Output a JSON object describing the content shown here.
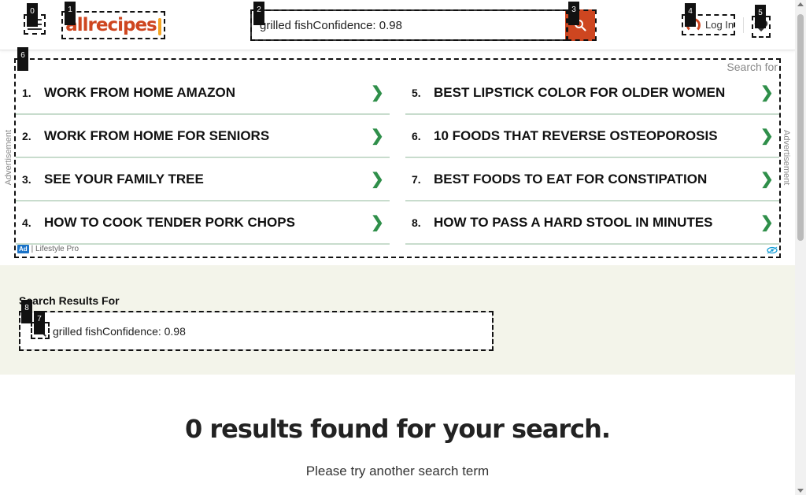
{
  "header": {
    "menu_icon": "hamburger-icon",
    "logo_text": "allrecipes",
    "search": {
      "value": "grilled fishConfidence: 0.98",
      "placeholder": ""
    },
    "search_icon": "search-icon",
    "login_label": "Log In",
    "login_icon": "user-circle-icon",
    "saved_icon": "heart-icon",
    "brand_color": "#ce4620"
  },
  "ad": {
    "side_label": "Advertisement",
    "search_for": "Search for",
    "left_items": [
      {
        "num": "1.",
        "text": "WORK FROM HOME AMAZON"
      },
      {
        "num": "2.",
        "text": "WORK FROM HOME FOR SENIORS"
      },
      {
        "num": "3.",
        "text": "SEE YOUR FAMILY TREE"
      },
      {
        "num": "4.",
        "text": "HOW TO COOK TENDER PORK CHOPS"
      }
    ],
    "right_items": [
      {
        "num": "5.",
        "text": "BEST LIPSTICK COLOR FOR OLDER WOMEN"
      },
      {
        "num": "6.",
        "text": "10 FOODS THAT REVERSE OSTEOPOROSIS"
      },
      {
        "num": "7.",
        "text": "BEST FOODS TO EAT FOR CONSTIPATION"
      },
      {
        "num": "8.",
        "text": "HOW TO PASS A HARD STOOL IN MINUTES"
      }
    ],
    "arrow": "❯",
    "badge": "Ad",
    "sponsor": "| Lifestyle Pro",
    "accent_color": "#2f8f4a"
  },
  "results": {
    "label": "Search Results For",
    "value": "grilled fishConfidence: 0.98",
    "empty_title": "0 results found for your search.",
    "empty_sub": "Please try another search term"
  },
  "tags": [
    "0",
    "1",
    "2",
    "3",
    "4",
    "5",
    "6",
    "7",
    "8"
  ]
}
